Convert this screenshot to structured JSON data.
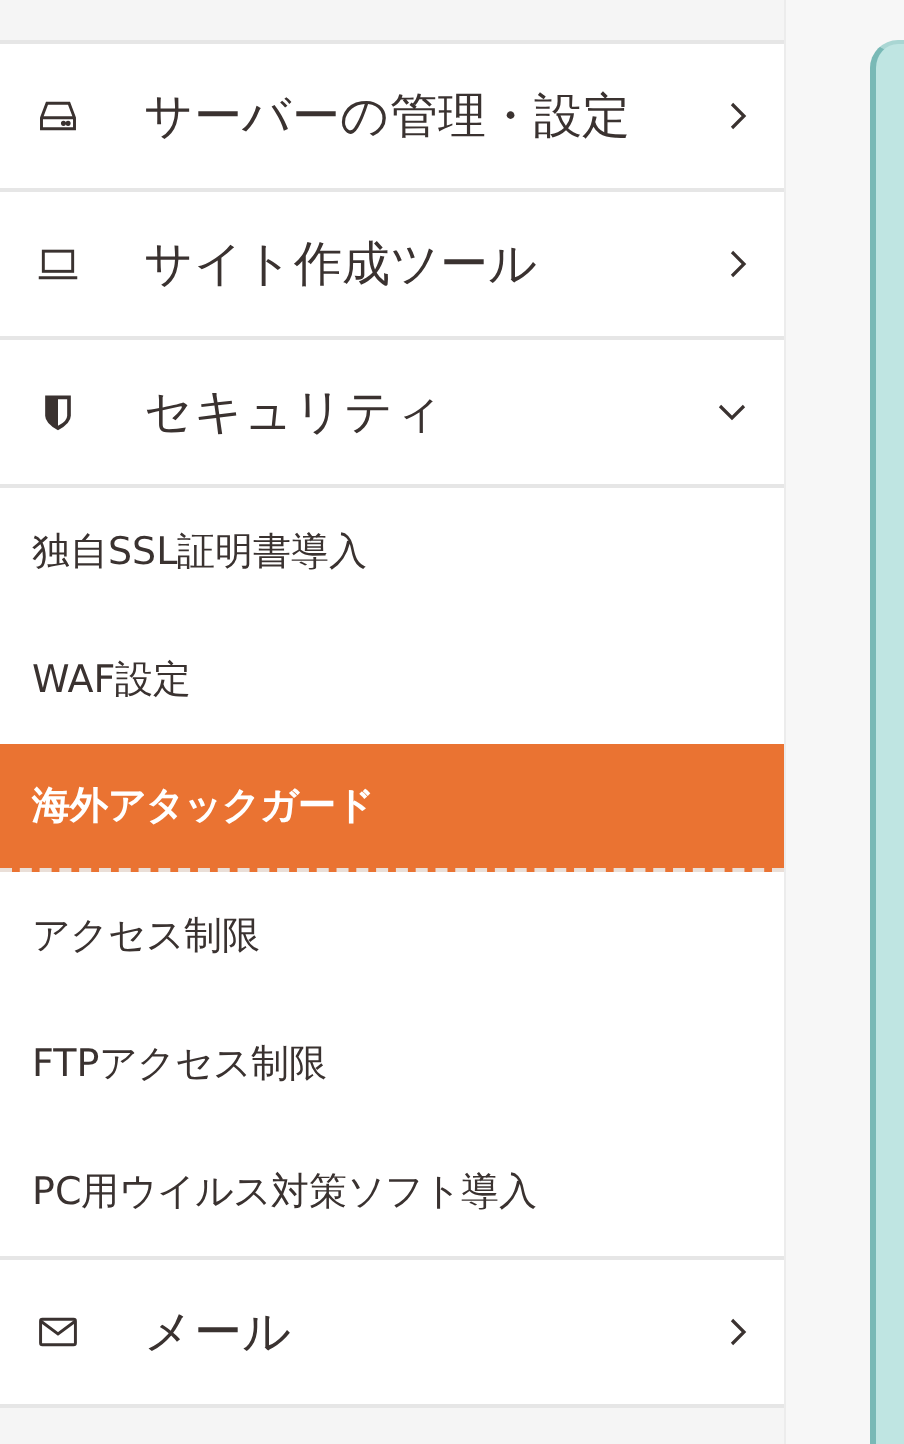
{
  "menu": [
    {
      "kind": "server",
      "label": "サーバーの管理・設定",
      "expanded": false
    },
    {
      "kind": "laptop",
      "label": "サイト作成ツール",
      "expanded": false
    },
    {
      "kind": "shield",
      "label": "セキュリティ",
      "expanded": true,
      "children": [
        {
          "label": "独自SSL証明書導入",
          "selected": false
        },
        {
          "label": "WAF設定",
          "selected": false
        },
        {
          "label": "海外アタックガード",
          "selected": true
        },
        {
          "label": "アクセス制限",
          "selected": false
        },
        {
          "label": "FTPアクセス制限",
          "selected": false
        },
        {
          "label": "PC用ウイルス対策ソフト導入",
          "selected": false
        }
      ]
    },
    {
      "kind": "mail",
      "label": "メール",
      "expanded": false
    }
  ]
}
